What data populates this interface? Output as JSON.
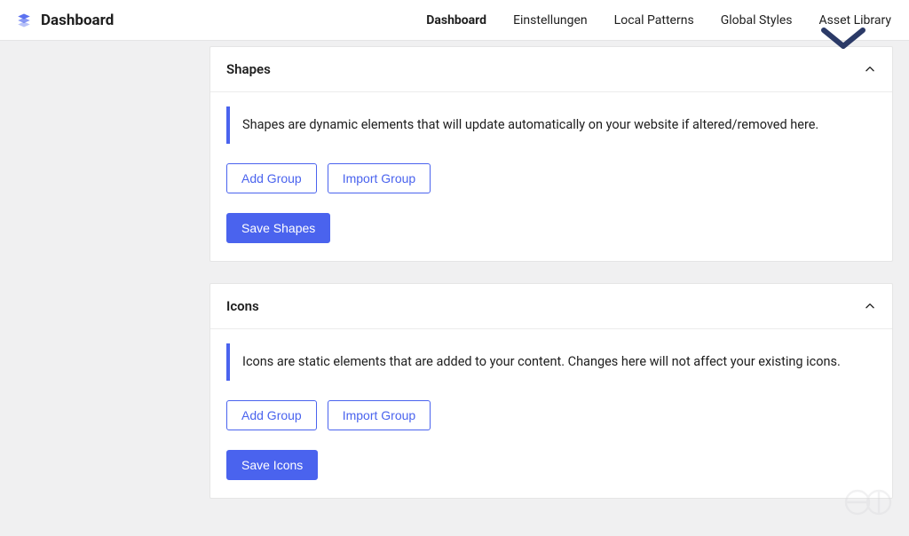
{
  "header": {
    "title": "Dashboard",
    "nav": [
      {
        "label": "Dashboard",
        "active": true
      },
      {
        "label": "Einstellungen",
        "active": false
      },
      {
        "label": "Local Patterns",
        "active": false
      },
      {
        "label": "Global Styles",
        "active": false
      },
      {
        "label": "Asset Library",
        "active": false
      }
    ]
  },
  "colors": {
    "accent": "#4a63ee"
  },
  "panels": {
    "shapes": {
      "title": "Shapes",
      "notice": "Shapes are dynamic elements that will update automatically on your website if altered/removed here.",
      "add_group_label": "Add Group",
      "import_group_label": "Import Group",
      "save_label": "Save Shapes"
    },
    "icons": {
      "title": "Icons",
      "notice": "Icons are static elements that are added to your content. Changes here will not affect your existing icons.",
      "add_group_label": "Add Group",
      "import_group_label": "Import Group",
      "save_label": "Save Icons"
    }
  }
}
